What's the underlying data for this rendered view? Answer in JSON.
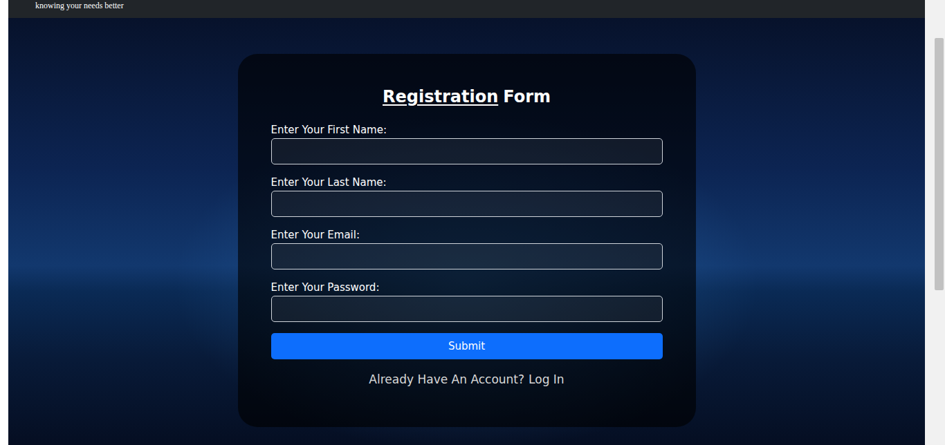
{
  "header": {
    "tagline": "knowing your needs better"
  },
  "form": {
    "title": {
      "underlined": "Registration",
      "rest": "Form"
    },
    "fields": [
      {
        "label": "Enter Your First Name:",
        "type": "text",
        "value": ""
      },
      {
        "label": "Enter Your Last Name:",
        "type": "text",
        "value": ""
      },
      {
        "label": "Enter Your Email:",
        "type": "email",
        "value": ""
      },
      {
        "label": "Enter Your Password:",
        "type": "password",
        "value": ""
      }
    ],
    "submit": "Submit",
    "footer": {
      "prompt": "Already Have An Account?",
      "link": "Log In"
    }
  }
}
